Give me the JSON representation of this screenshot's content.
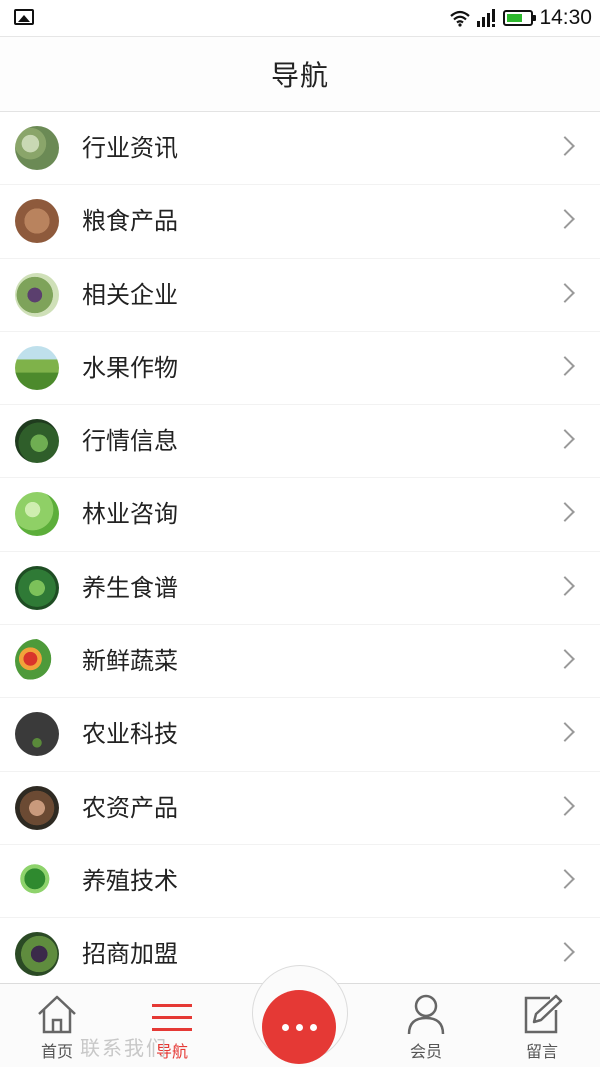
{
  "status_bar": {
    "time": "14:30"
  },
  "header": {
    "title": "导航"
  },
  "nav_items": [
    {
      "label": "行业资讯",
      "icon": "eggplant-photo-icon"
    },
    {
      "label": "粮食产品",
      "icon": "soil-photo-icon"
    },
    {
      "label": "相关企业",
      "icon": "grape-photo-icon"
    },
    {
      "label": "水果作物",
      "icon": "field-photo-icon"
    },
    {
      "label": "行情信息",
      "icon": "leaf-photo-icon"
    },
    {
      "label": "林业咨询",
      "icon": "green-bokeh-photo-icon"
    },
    {
      "label": "养生食谱",
      "icon": "pea-pod-photo-icon"
    },
    {
      "label": "新鲜蔬菜",
      "icon": "vegetables-photo-icon"
    },
    {
      "label": "农业科技",
      "icon": "sprout-photo-icon"
    },
    {
      "label": "农资产品",
      "icon": "hands-soil-photo-icon"
    },
    {
      "label": "养殖技术",
      "icon": "bok-choy-photo-icon"
    },
    {
      "label": "招商加盟",
      "icon": "eggplant-dark-photo-icon"
    }
  ],
  "ghost_text": "联系我们",
  "tabbar": {
    "home": "首页",
    "nav": "导航",
    "member": "会员",
    "message": "留言"
  },
  "colors": {
    "accent": "#e53935",
    "battery": "#2eb82e"
  }
}
